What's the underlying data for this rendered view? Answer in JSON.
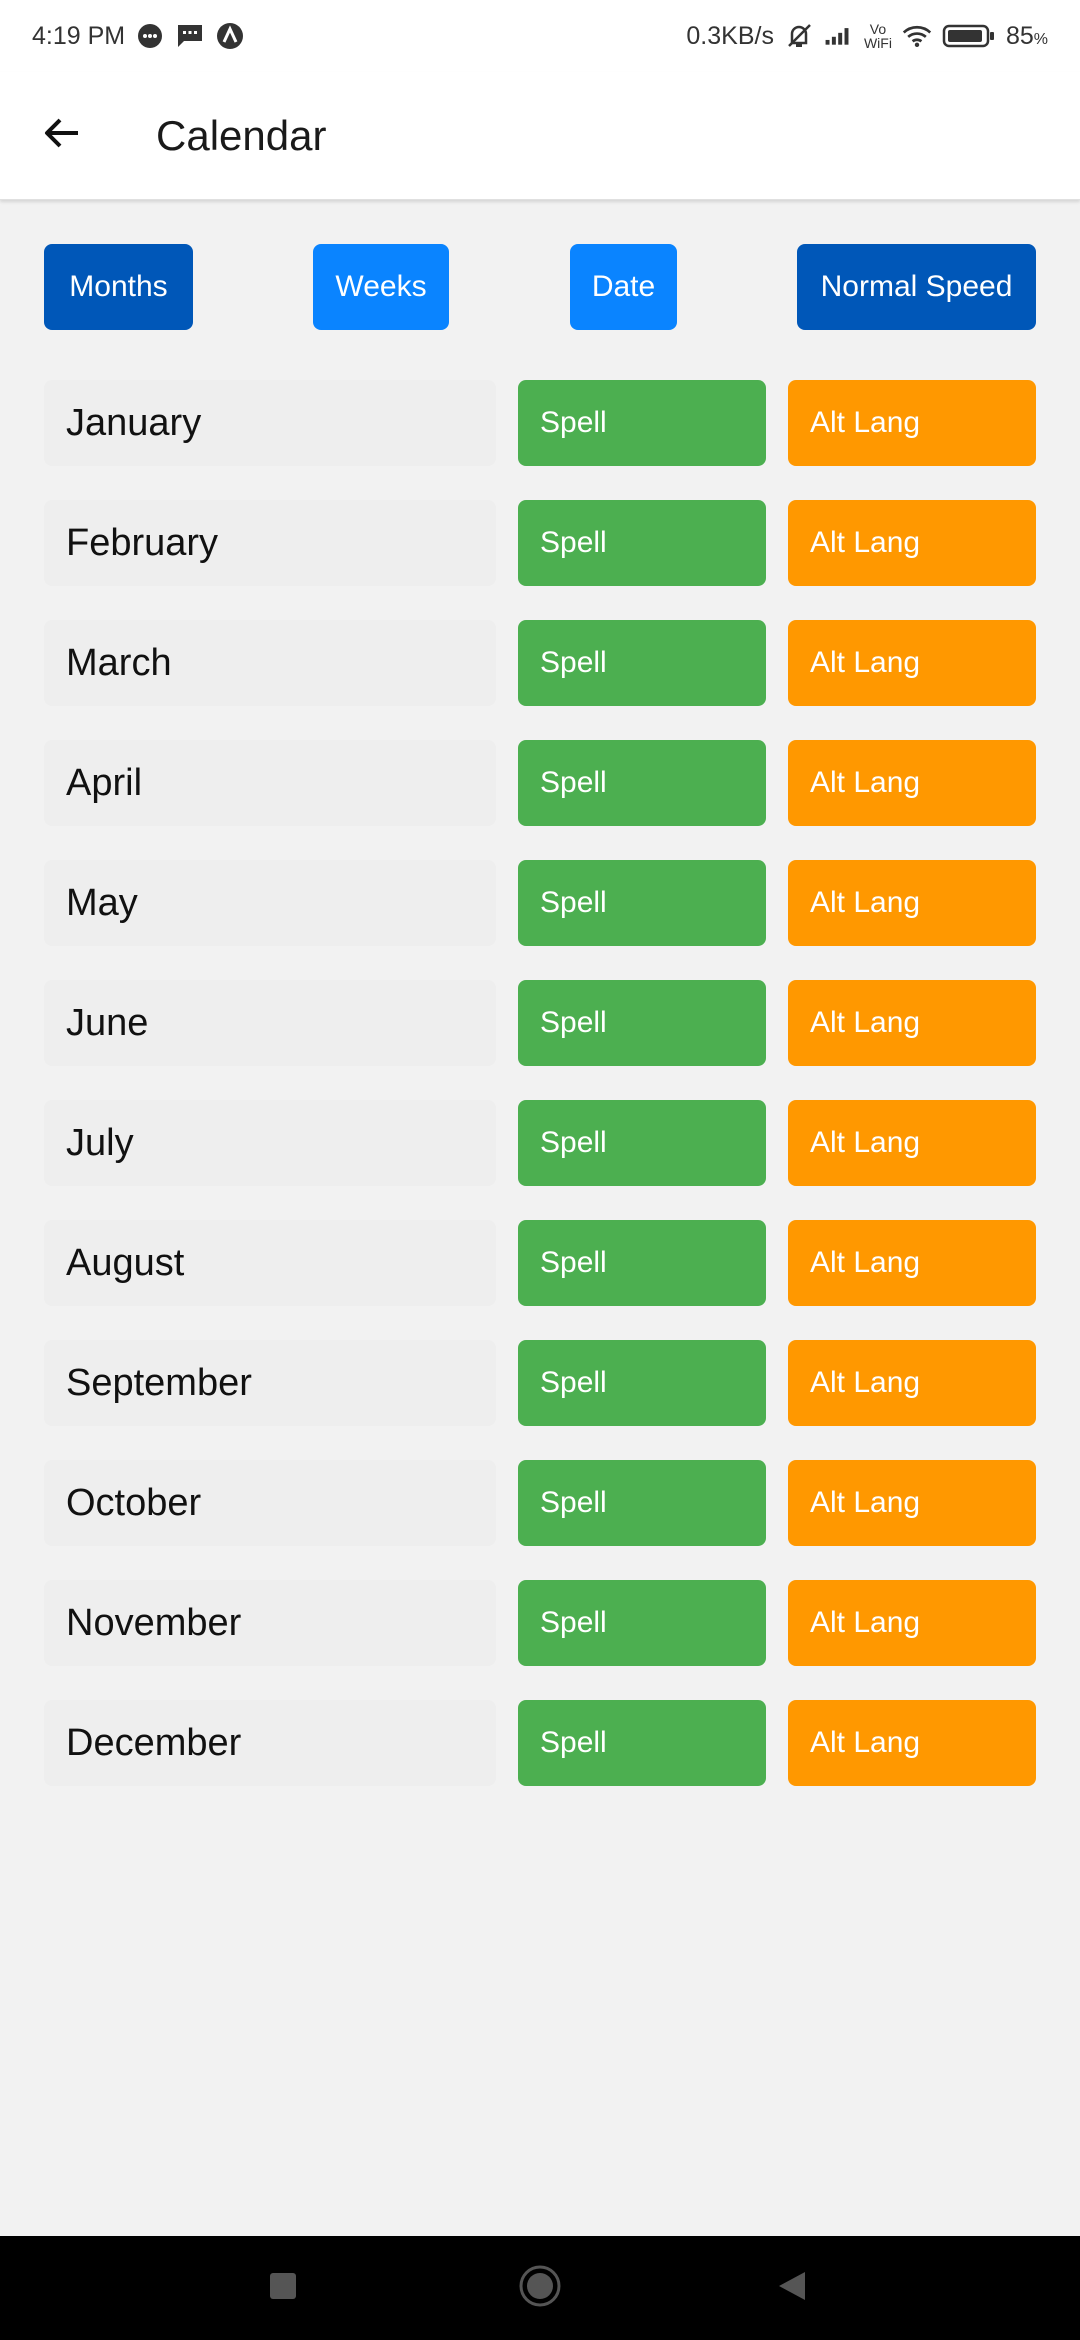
{
  "status_bar": {
    "time": "4:19 PM",
    "speed": "0.3KB/s",
    "vowifi_top": "Vo",
    "vowifi_bottom": "WiFi",
    "battery": "85"
  },
  "app_bar": {
    "title": "Calendar"
  },
  "mode_buttons": [
    {
      "label": "Months",
      "color": "#0057b8"
    },
    {
      "label": "Weeks",
      "color": "#0a84ff"
    },
    {
      "label": "Date",
      "color": "#0a84ff"
    },
    {
      "label": "Normal Speed",
      "color": "#0057b8"
    }
  ],
  "months": [
    {
      "name": "January",
      "spell": "Spell",
      "alt": "Alt Lang"
    },
    {
      "name": "February",
      "spell": "Spell",
      "alt": "Alt Lang"
    },
    {
      "name": "March",
      "spell": "Spell",
      "alt": "Alt Lang"
    },
    {
      "name": "April",
      "spell": "Spell",
      "alt": "Alt Lang"
    },
    {
      "name": "May",
      "spell": "Spell",
      "alt": "Alt Lang"
    },
    {
      "name": "June",
      "spell": "Spell",
      "alt": "Alt Lang"
    },
    {
      "name": "July",
      "spell": "Spell",
      "alt": "Alt Lang"
    },
    {
      "name": "August",
      "spell": "Spell",
      "alt": "Alt Lang"
    },
    {
      "name": "September",
      "spell": "Spell",
      "alt": "Alt Lang"
    },
    {
      "name": "October",
      "spell": "Spell",
      "alt": "Alt Lang"
    },
    {
      "name": "November",
      "spell": "Spell",
      "alt": "Alt Lang"
    },
    {
      "name": "December",
      "spell": "Spell",
      "alt": "Alt Lang"
    }
  ],
  "colors": {
    "spell": "#4caf50",
    "alt": "#ff9800"
  },
  "icons": {
    "back": "arrow-left-icon",
    "nav_recent": "square-icon",
    "nav_home": "circle-icon",
    "nav_back": "triangle-back-icon"
  }
}
